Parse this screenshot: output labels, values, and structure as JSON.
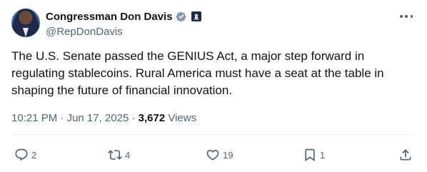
{
  "author": {
    "display_name": "Congressman Don Davis",
    "handle": "@RepDonDavis"
  },
  "tweet": {
    "text": "The U.S. Senate passed the GENIUS Act, a major step forward in regulating stablecoins. Rural America must have a seat at the table in shaping the future of financial innovation."
  },
  "meta": {
    "time": "10:21 PM",
    "separator": " · ",
    "date": "Jun 17, 2025",
    "views_count": "3,672",
    "views_label": " Views"
  },
  "actions": {
    "replies": "2",
    "reposts": "4",
    "likes": "19",
    "bookmarks": "1"
  },
  "colors": {
    "verified": "#829aab",
    "secondary_text": "#536471",
    "primary_text": "#0f1419"
  },
  "icons": [
    "verified-badge-icon",
    "government-badge-icon",
    "more-icon",
    "reply-icon",
    "repost-icon",
    "like-icon",
    "bookmark-icon",
    "share-icon"
  ]
}
